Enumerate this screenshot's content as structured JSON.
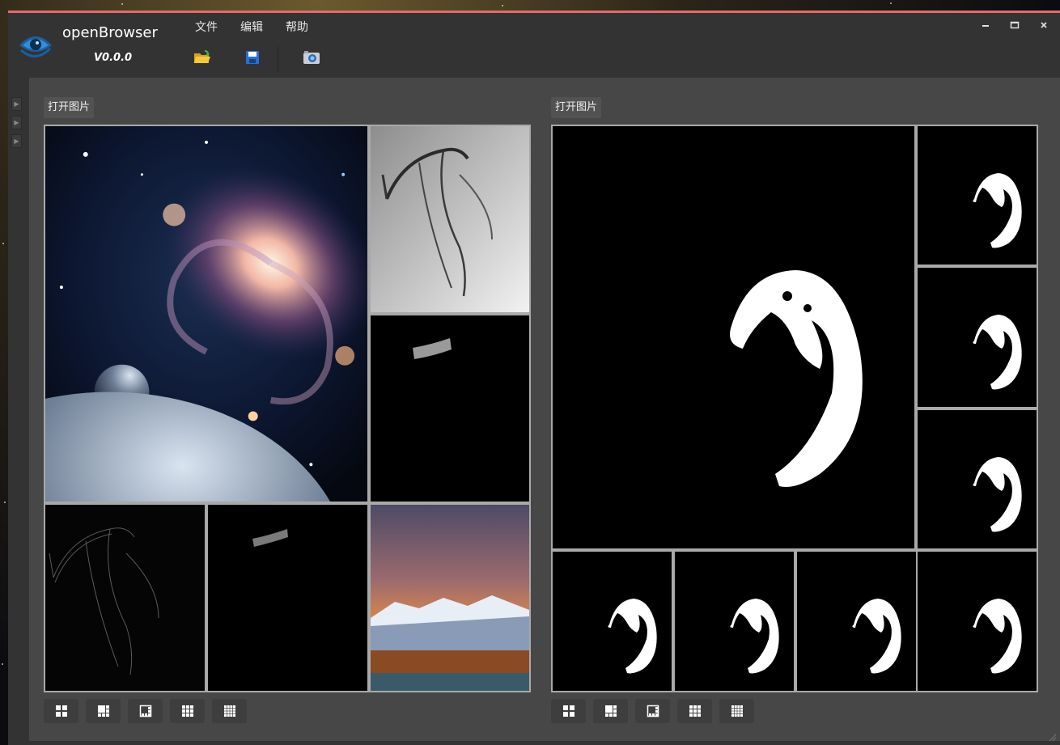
{
  "app": {
    "name": "openBrowser",
    "version": "V0.0.0"
  },
  "menu": [
    "文件",
    "编辑",
    "帮助"
  ],
  "toolbar_icons": [
    "open-folder-icon",
    "save-icon",
    "camera-icon"
  ],
  "window_controls": [
    "minimize-icon",
    "maximize-icon",
    "close-icon"
  ],
  "left_panel": {
    "title": "打开图片",
    "images": [
      "galaxy",
      "angiogram",
      "vessel-segment",
      "edge-map",
      "vessel-segment-small",
      "mountain-sunset"
    ]
  },
  "right_panel": {
    "title": "打开图片",
    "images": [
      "mask-large",
      "mask",
      "mask",
      "mask",
      "mask",
      "mask",
      "mask",
      "mask"
    ]
  },
  "layout_buttons": [
    "layout-2x2-icon",
    "layout-1plus3-icon",
    "layout-1plus5-icon",
    "layout-3x3-icon",
    "layout-4x4-icon"
  ],
  "colors": {
    "accent": "#e36b6b",
    "window_bg": "#333333",
    "workspace_bg": "#474747",
    "cell_border": "#a9a9a9"
  }
}
